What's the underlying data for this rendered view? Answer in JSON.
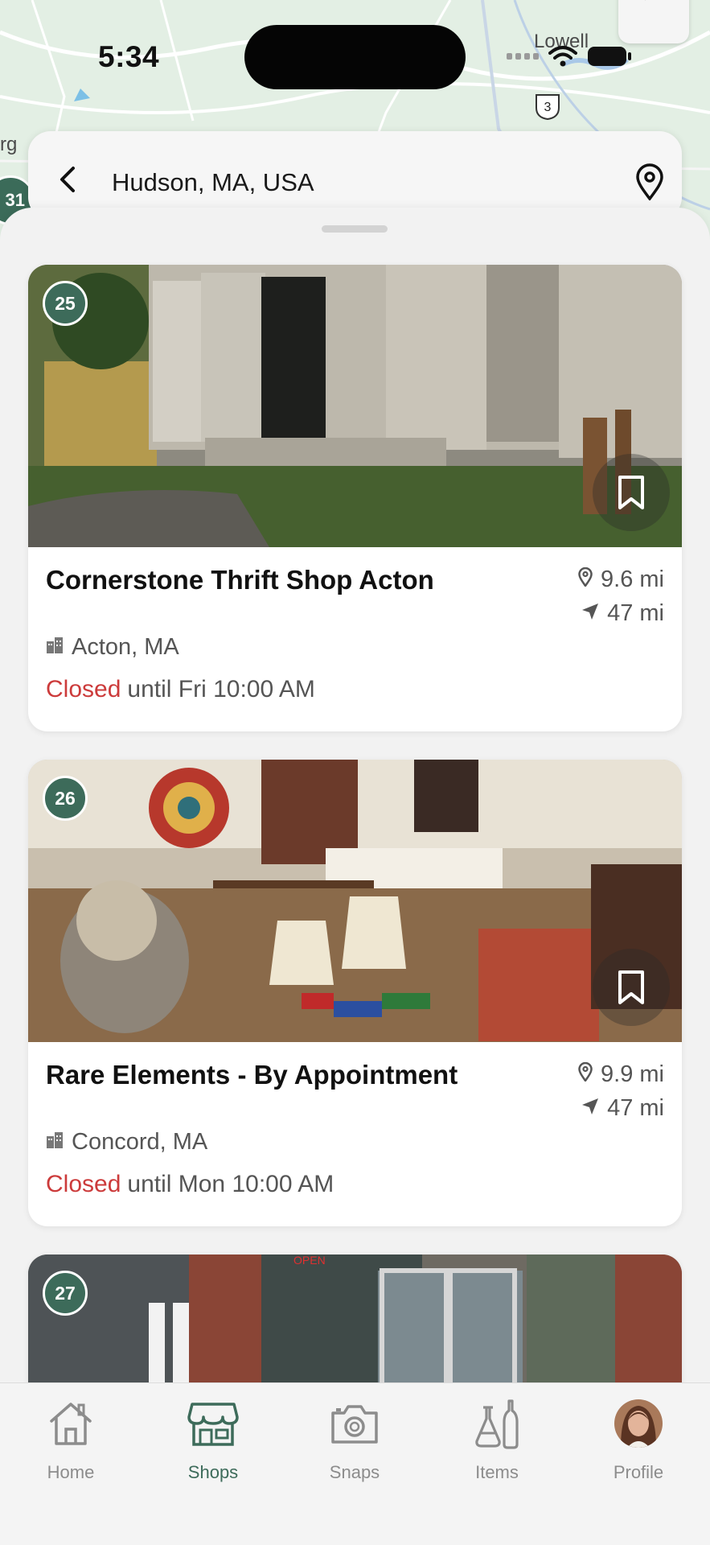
{
  "status_bar": {
    "time": "5:34"
  },
  "map": {
    "label_city": "Lowell",
    "label_partial": "rg",
    "route_number": "3",
    "cluster_partial": "31"
  },
  "search": {
    "location": "Hudson, MA, USA"
  },
  "shops": [
    {
      "rank": "25",
      "name": "Cornerstone Thrift Shop Acton",
      "distance_from_location": "9.6 mi",
      "distance_from_me": "47 mi",
      "city": "Acton, MA",
      "status": "Closed",
      "hours": "until Fri 10:00 AM"
    },
    {
      "rank": "26",
      "name": "Rare Elements - By Appointment",
      "distance_from_location": "9.9 mi",
      "distance_from_me": "47 mi",
      "city": "Concord, MA",
      "status": "Closed",
      "hours": "until Mon 10:00 AM"
    },
    {
      "rank": "27",
      "sign_text": "OPEN"
    }
  ],
  "tabbar": {
    "active": "Shops",
    "tabs": [
      {
        "label": "Home",
        "icon": "home-icon"
      },
      {
        "label": "Shops",
        "icon": "storefront-icon"
      },
      {
        "label": "Snaps",
        "icon": "camera-icon"
      },
      {
        "label": "Items",
        "icon": "items-icon"
      },
      {
        "label": "Profile",
        "icon": "avatar"
      }
    ]
  },
  "colors": {
    "brand_green": "#3d6b5a",
    "closed_red": "#cc3b3b",
    "text_muted": "#555555",
    "sheet_bg": "#f2f2f2"
  }
}
